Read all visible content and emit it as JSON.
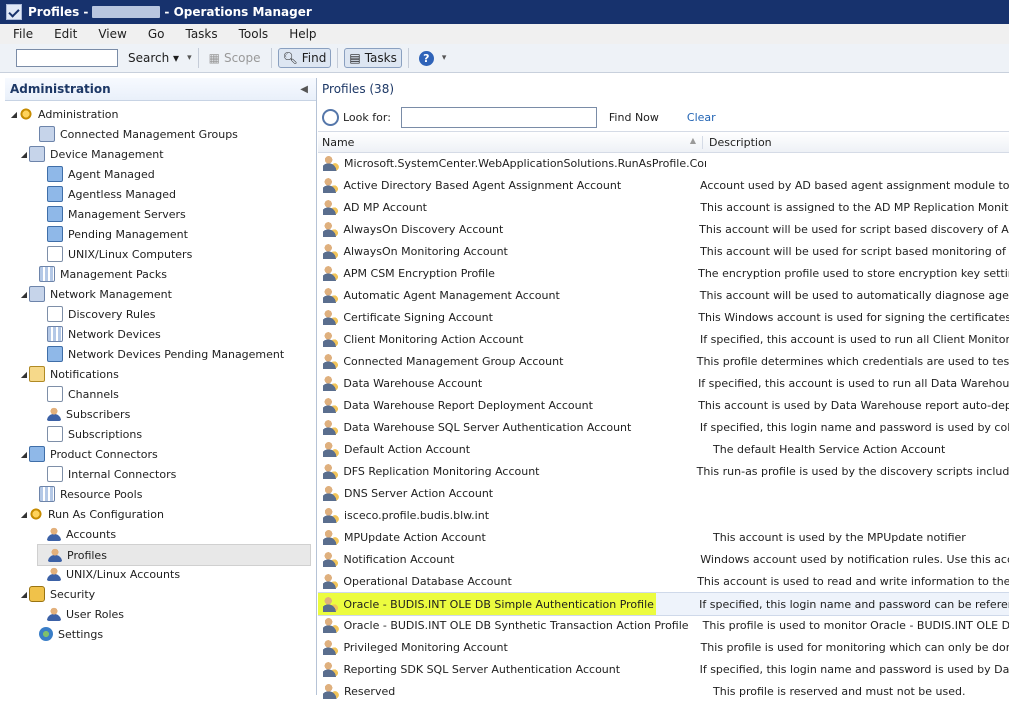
{
  "window": {
    "title_prefix": "Profiles -",
    "title_suffix": "- Operations Manager"
  },
  "menu": [
    "File",
    "Edit",
    "View",
    "Go",
    "Tasks",
    "Tools",
    "Help"
  ],
  "toolbar": {
    "search_label": "Search ▾",
    "scope_label": "Scope",
    "find_label": "Find",
    "tasks_label": "Tasks"
  },
  "left": {
    "header": "Administration",
    "items": [
      {
        "label": "Administration",
        "level": 0,
        "icon": "gear-icon",
        "exp": "◢"
      },
      {
        "label": "Connected Management Groups",
        "level": 1,
        "icon": "box-icon",
        "exp": ""
      },
      {
        "label": "Device Management",
        "level": 1,
        "icon": "box-icon",
        "exp": "◢"
      },
      {
        "label": "Agent Managed",
        "level": 2,
        "icon": "pc-icon",
        "exp": ""
      },
      {
        "label": "Agentless Managed",
        "level": 2,
        "icon": "pc-icon",
        "exp": ""
      },
      {
        "label": "Management Servers",
        "level": 2,
        "icon": "pc-icon",
        "exp": ""
      },
      {
        "label": "Pending Management",
        "level": 2,
        "icon": "pc-icon",
        "exp": ""
      },
      {
        "label": "UNIX/Linux Computers",
        "level": 2,
        "icon": "doc-icon",
        "exp": ""
      },
      {
        "label": "Management Packs",
        "level": 1,
        "icon": "grid-icon",
        "exp": ""
      },
      {
        "label": "Network Management",
        "level": 1,
        "icon": "box-icon",
        "exp": "◢"
      },
      {
        "label": "Discovery Rules",
        "level": 2,
        "icon": "doc-icon",
        "exp": ""
      },
      {
        "label": "Network Devices",
        "level": 2,
        "icon": "grid-icon",
        "exp": ""
      },
      {
        "label": "Network Devices Pending Management",
        "level": 2,
        "icon": "pc-icon",
        "exp": ""
      },
      {
        "label": "Notifications",
        "level": 1,
        "icon": "env-icon",
        "exp": "◢"
      },
      {
        "label": "Channels",
        "level": 2,
        "icon": "doc-icon",
        "exp": ""
      },
      {
        "label": "Subscribers",
        "level": 2,
        "icon": "user-icon",
        "exp": ""
      },
      {
        "label": "Subscriptions",
        "level": 2,
        "icon": "doc-icon",
        "exp": ""
      },
      {
        "label": "Product Connectors",
        "level": 1,
        "icon": "pc-icon",
        "exp": "◢"
      },
      {
        "label": "Internal Connectors",
        "level": 2,
        "icon": "doc-icon",
        "exp": ""
      },
      {
        "label": "Resource Pools",
        "level": 1,
        "icon": "grid-icon",
        "exp": ""
      },
      {
        "label": "Run As Configuration",
        "level": 1,
        "icon": "gear-icon",
        "exp": "◢"
      },
      {
        "label": "Accounts",
        "level": 2,
        "icon": "user-icon",
        "exp": ""
      },
      {
        "label": "Profiles",
        "level": 2,
        "icon": "user-icon",
        "exp": "",
        "selected": true
      },
      {
        "label": "UNIX/Linux Accounts",
        "level": 2,
        "icon": "user-icon",
        "exp": ""
      },
      {
        "label": "Security",
        "level": 1,
        "icon": "lock-icon",
        "exp": "◢"
      },
      {
        "label": "User Roles",
        "level": 2,
        "icon": "user-icon",
        "exp": ""
      },
      {
        "label": "Settings",
        "level": 1,
        "icon": "globe-icon",
        "exp": ""
      }
    ]
  },
  "right": {
    "title": "Profiles (38)",
    "look_for_label": "Look for:",
    "find_now": "Find Now",
    "clear": "Clear",
    "col_name": "Name",
    "col_desc": "Description",
    "rows": [
      {
        "name": "Microsoft.SystemCenter.WebApplicationSolutions.RunAsProfile.Con...",
        "desc": ""
      },
      {
        "name": "Active Directory Based Agent Assignment Account",
        "desc": "Account used by AD based agent assignment module to p"
      },
      {
        "name": "AD MP Account",
        "desc": "This account is assigned to the AD MP Replication Monitor"
      },
      {
        "name": "AlwaysOn Discovery Account",
        "desc": "This account will be used for script based discovery of Alw"
      },
      {
        "name": "AlwaysOn Monitoring Account",
        "desc": "This account will be used for script based monitoring of Al"
      },
      {
        "name": "APM CSM Encryption Profile",
        "desc": "The encryption profile used to store encryption key setting"
      },
      {
        "name": "Automatic Agent Management Account",
        "desc": "This account will be used to automatically diagnose agent"
      },
      {
        "name": "Certificate Signing Account",
        "desc": "This Windows account is used for signing the certificates u"
      },
      {
        "name": "Client Monitoring Action Account",
        "desc": "If specified, this account is used to run all Client Monitorin"
      },
      {
        "name": "Connected Management Group Account",
        "desc": "This profile determines which credentials are used to test c"
      },
      {
        "name": "Data Warehouse Account",
        "desc": "If specified, this account is used to run all Data Warehouse"
      },
      {
        "name": "Data Warehouse Report Deployment Account",
        "desc": "This account is used by Data Warehouse report auto-deplo"
      },
      {
        "name": "Data Warehouse SQL Server Authentication Account",
        "desc": "If specified, this login name and password is used by colle"
      },
      {
        "name": "Default Action Account",
        "desc": "The default Health Service Action Account"
      },
      {
        "name": "DFS Replication Monitoring Account",
        "desc": "This run-as profile is used by the discovery scripts included"
      },
      {
        "name": "DNS Server Action Account",
        "desc": ""
      },
      {
        "name": "isceco.profile.budis.blw.int",
        "desc": ""
      },
      {
        "name": "MPUpdate Action Account",
        "desc": "This account is used by the MPUpdate notifier"
      },
      {
        "name": "Notification Account",
        "desc": "Windows account used by notification rules. Use this acco"
      },
      {
        "name": "Operational Database Account",
        "desc": "This account is used to read and write information to the O"
      },
      {
        "name": "Oracle - BUDIS.INT OLE DB Simple Authentication Profile",
        "desc": "If specified, this login name and password can be referenc",
        "highlight": true
      },
      {
        "name": "Oracle - BUDIS.INT OLE DB Synthetic Transaction Action Profile",
        "desc": "This profile is used to monitor Oracle - BUDIS.INT OLE DB"
      },
      {
        "name": "Privileged Monitoring Account",
        "desc": "This profile is used for monitoring which can only be done"
      },
      {
        "name": "Reporting SDK SQL Server Authentication Account",
        "desc": "If specified, this login name and password is used by Data"
      },
      {
        "name": "Reserved",
        "desc": "This profile is reserved and must not be used."
      }
    ]
  }
}
